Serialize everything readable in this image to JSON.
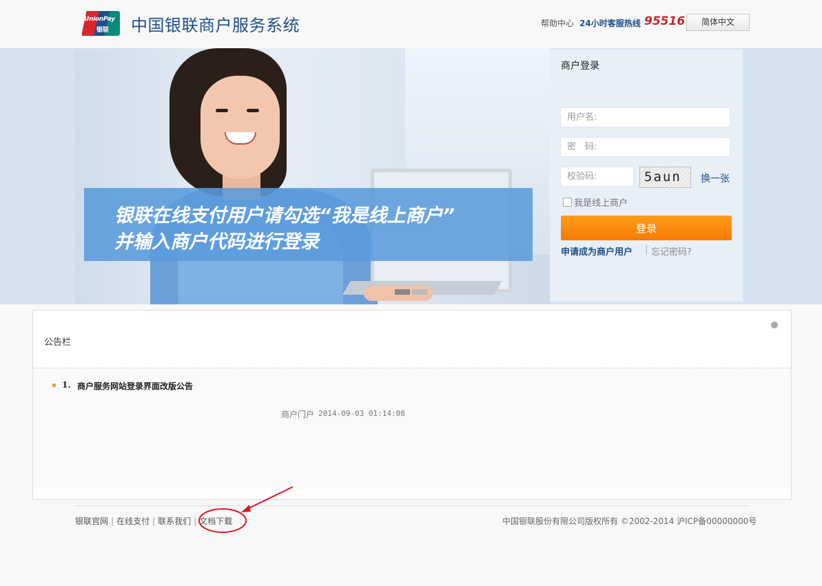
{
  "header": {
    "logo_text_top": "UnionPay",
    "logo_text_bottom": "银联",
    "system_title": "中国银联商户服务系统",
    "help_link": "帮助中心",
    "hotline_label": "24小时客服热线",
    "hotline_number": "95516",
    "language_button": "简体中文"
  },
  "banner": {
    "line1": "银联在线支付用户请勾选“我是线上商户”",
    "line2": "并输入商户代码进行登录"
  },
  "login": {
    "title": "商户登录",
    "username_placeholder": "用户名:",
    "password_placeholder": "密　码:",
    "captcha_placeholder": "校验码:",
    "captcha_text": "5aun",
    "refresh_label": "换一张",
    "online_merchant_label": "我是线上商户",
    "login_button": "登录",
    "apply_link": "申请成为商户用户",
    "separator": "|",
    "forgot_link": "忘记密码?"
  },
  "notice": {
    "title": "公告栏",
    "items": [
      {
        "number": "1.",
        "title": "商户服务网站登录界面改版公告",
        "source": "商户门户",
        "datetime": "2014-09-03 01:14:08"
      }
    ]
  },
  "footer": {
    "links": [
      "银联官网",
      "在线支付",
      "联系我们",
      "文档下载"
    ],
    "copyright": "中国银联股份有限公司版权所有 ©2002-2014 沪ICP备00000000号"
  },
  "colors": {
    "brand_blue": "#1e4f8a",
    "login_orange": "#f47b02",
    "annotation_red": "#e0141e"
  }
}
